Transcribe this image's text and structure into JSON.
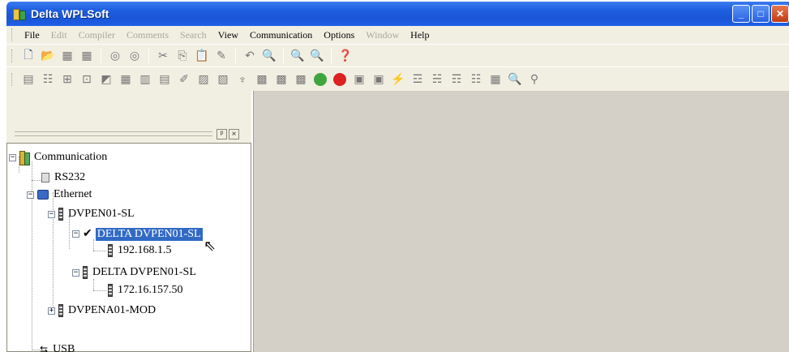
{
  "window": {
    "title": "Delta WPLSoft",
    "minimize_glyph": "_",
    "maximize_glyph": "□",
    "close_glyph": "✕"
  },
  "menu": [
    {
      "label": "File",
      "enabled": true
    },
    {
      "label": "Edit",
      "enabled": false
    },
    {
      "label": "Compiler",
      "enabled": false
    },
    {
      "label": "Comments",
      "enabled": false
    },
    {
      "label": "Search",
      "enabled": false
    },
    {
      "label": "View",
      "enabled": true
    },
    {
      "label": "Communication",
      "enabled": true
    },
    {
      "label": "Options",
      "enabled": true
    },
    {
      "label": "Window",
      "enabled": false
    },
    {
      "label": "Help",
      "enabled": true
    }
  ],
  "panel": {
    "pin_glyph": "ᵖ",
    "close_glyph": "×"
  },
  "tree": {
    "root": "Communication",
    "rs232": "RS232",
    "ethernet": "Ethernet",
    "dvpen01": "DVPEN01-SL",
    "device1": "DELTA DVPEN01-SL",
    "ip1": "192.168.1.5",
    "device2": "DELTA DVPEN01-SL",
    "ip2": "172.16.157.50",
    "dvpena01": "DVPENA01-MOD",
    "usb": "USB"
  },
  "accent": {
    "titlebar": "#1e5fe0",
    "selection": "#316ac5",
    "frame": "#f1efe2"
  }
}
